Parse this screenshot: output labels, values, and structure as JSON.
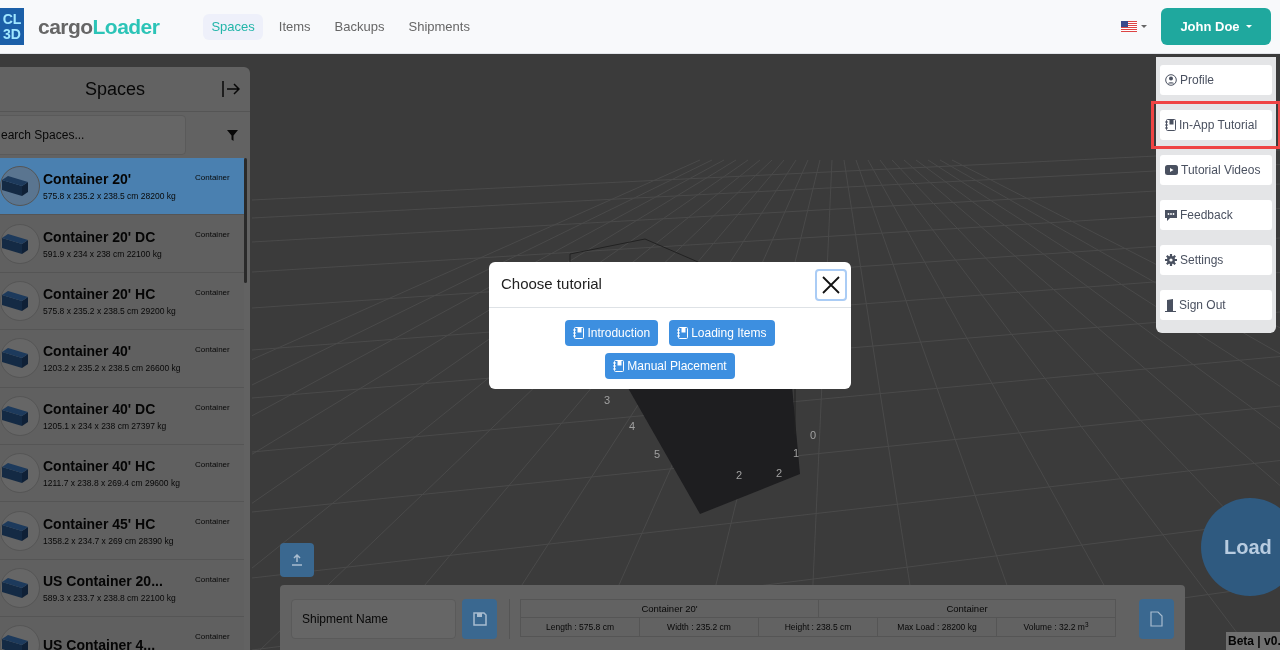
{
  "navbar": {
    "logo_lines": [
      "CL",
      "3D"
    ],
    "brand": {
      "part_1": "cargo",
      "part_2": "Loader"
    },
    "tabs": [
      {
        "label": "Spaces",
        "selected": true
      },
      {
        "label": "Items",
        "selected": false
      },
      {
        "label": "Backups",
        "selected": false
      },
      {
        "label": "Shipments",
        "selected": false
      }
    ],
    "user_button": "John Doe"
  },
  "user_menu": [
    {
      "kind": "profile",
      "label": "Profile",
      "highlighted": false
    },
    {
      "kind": "tutorial",
      "label": "In-App Tutorial",
      "highlighted": true
    },
    {
      "kind": "video",
      "label": "Tutorial Videos",
      "highlighted": false
    },
    {
      "kind": "feedback",
      "label": "Feedback",
      "highlighted": false
    },
    {
      "kind": "settings",
      "label": "Settings",
      "highlighted": false
    },
    {
      "kind": "signout",
      "label": "Sign Out",
      "highlighted": false
    }
  ],
  "sidebar": {
    "title": "Spaces",
    "search": {
      "placeholder": "earch Spaces..."
    },
    "rows": [
      {
        "name": "Container 20'",
        "dimensions": "575.8 x 235.2 x 238.5 cm 28200 kg",
        "type": "Container",
        "selected": true
      },
      {
        "name": "Container 20' DC",
        "dimensions": "591.9 x 234 x 238 cm 22100 kg",
        "type": "Container",
        "selected": false
      },
      {
        "name": "Container 20' HC",
        "dimensions": "575.8 x 235.2 x 238.5 cm 29200 kg",
        "type": "Container",
        "selected": false
      },
      {
        "name": "Container 40'",
        "dimensions": "1203.2 x 235.2 x 238.5 cm 26600 kg",
        "type": "Container",
        "selected": false
      },
      {
        "name": "Container 40' DC",
        "dimensions": "1205.1 x 234 x 238 cm 27397 kg",
        "type": "Container",
        "selected": false
      },
      {
        "name": "Container 40' HC",
        "dimensions": "1211.7 x 238.8 x 269.4 cm 29600 kg",
        "type": "Container",
        "selected": false
      },
      {
        "name": "Container 45' HC",
        "dimensions": "1358.2 x 234.7 x 269 cm 28390 kg",
        "type": "Container",
        "selected": false
      },
      {
        "name": "US Container 20...",
        "dimensions": "589.3 x 233.7 x 238.8 cm 22100 kg",
        "type": "Container",
        "selected": false
      },
      {
        "name": "US Container 4...",
        "type": "Container",
        "selected": false
      }
    ]
  },
  "scene": {
    "axis_labels": [
      "3",
      "4",
      "5",
      "0",
      "1",
      "2",
      "2"
    ]
  },
  "bottom_panel": {
    "shipment_name": {
      "placeholder": "Shipment Name"
    },
    "summary": {
      "name": "Container 20'",
      "type": "Container",
      "specs": [
        "Length : 575.8 cm",
        "Width : 235.2 cm",
        "Height : 238.5 cm",
        "Max Load : 28200 kg",
        "Volume : 32.2 m$^{3}$"
      ]
    }
  },
  "load_button": "Load",
  "version": "Beta | v0.",
  "modal": {
    "title": "Choose tutorial",
    "buttons": [
      "Introduction",
      "Loading Items",
      "Manual Placement"
    ]
  }
}
